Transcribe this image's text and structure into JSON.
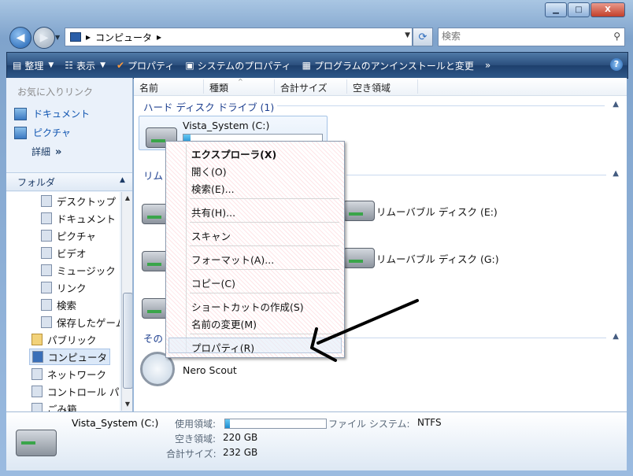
{
  "window": {
    "caption_buttons": {
      "minimize": "▁",
      "maximize": "□",
      "close": "X"
    }
  },
  "address": {
    "back_label": "◀",
    "forward_label": "▶",
    "breadcrumb": [
      "▸",
      "コンピュータ",
      "▸"
    ],
    "search_placeholder": "検索"
  },
  "toolbar": {
    "items": [
      {
        "label": "整理",
        "icon": "organize-icon",
        "dropdown": true
      },
      {
        "label": "表示",
        "icon": "views-icon",
        "dropdown": true
      },
      {
        "label": "プロパティ",
        "icon": "properties-check-icon"
      },
      {
        "label": "システムのプロパティ",
        "icon": "system-properties-icon"
      },
      {
        "label": "プログラムのアンインストールと変更",
        "icon": "uninstall-program-icon"
      },
      {
        "label": "»",
        "icon": "overflow-chevron-icon"
      }
    ],
    "help_label": "?"
  },
  "nav": {
    "favorites_header": "お気に入りリンク",
    "favorites": [
      "ドキュメント",
      "ピクチャ"
    ],
    "more_label": "詳細",
    "more_chevron": "»",
    "folders_header": "フォルダ",
    "folder_tree": [
      "デスクトップ",
      "ドキュメント",
      "ピクチャ",
      "ビデオ",
      "ミュージック",
      "リンク",
      "検索",
      "保存したゲーム",
      "パブリック",
      "コンピュータ",
      "ネットワーク",
      "コントロール パ",
      "ごみ箱"
    ],
    "selected": "コンピュータ"
  },
  "columns": [
    "名前",
    "種類",
    "合計サイズ",
    "空き領域"
  ],
  "groups": {
    "hdd": "ハード ディスク ドライブ (1)",
    "removable": "リム",
    "other": "その"
  },
  "items": {
    "c_drive": "Vista_System (C:)",
    "removable_e": "リムーバブル ディスク (E:)",
    "removable_g": "リムーバブル ディスク (G:)",
    "nero": "Nero Scout"
  },
  "context_menu": {
    "items": [
      {
        "label": "エクスプローラ(X)",
        "bold": true
      },
      {
        "label": "開く(O)"
      },
      {
        "label": "検索(E)..."
      },
      {
        "label": "共有(H)..."
      },
      {
        "label": "スキャン"
      },
      {
        "label": "フォーマット(A)..."
      },
      {
        "label": "コピー(C)"
      },
      {
        "label": "ショートカットの作成(S)"
      },
      {
        "label": "名前の変更(M)"
      },
      {
        "label": "プロパティ(R)",
        "highlighted": true
      }
    ]
  },
  "details": {
    "name": "Vista_System (C:)",
    "used_label": "使用領域:",
    "used_fraction": 0.05,
    "free_label": "空き領域:",
    "free_value": "220 GB",
    "total_label": "合計サイズ:",
    "total_value": "232 GB",
    "fs_label": "ファイル システム:",
    "fs_value": "NTFS"
  },
  "colors": {
    "toolbar_bg": "#2a4e7d",
    "link_blue": "#0d53b0",
    "usage_bar": "#1b8cd0"
  }
}
